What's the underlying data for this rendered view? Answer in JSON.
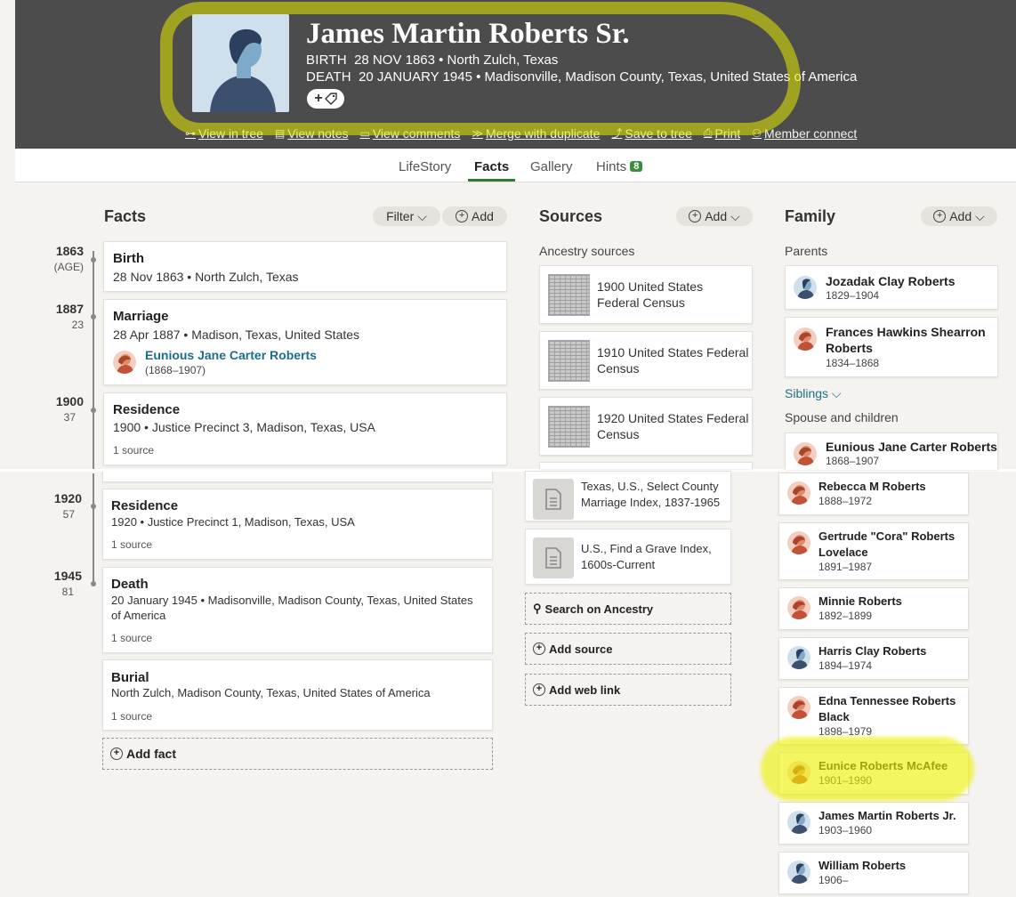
{
  "person": {
    "name": "James Martin Roberts Sr.",
    "birth_label": "BIRTH",
    "birth_value": "28 NOV 1863 • North Zulch, Texas",
    "death_label": "DEATH",
    "death_value": "20 JANUARY 1945 • Madisonville, Madison County, Texas, United States of America",
    "tag_button": "+"
  },
  "actions": [
    {
      "icon": "tree-icon",
      "label": "View in tree"
    },
    {
      "icon": "notes-icon",
      "label": "View notes"
    },
    {
      "icon": "comments-icon",
      "label": "View comments"
    },
    {
      "icon": "merge-icon",
      "label": "Merge with duplicate"
    },
    {
      "icon": "save-icon",
      "label": "Save to tree"
    },
    {
      "icon": "print-icon",
      "label": "Print"
    },
    {
      "icon": "member-icon",
      "label": "Member connect"
    }
  ],
  "tabs": [
    {
      "label": "LifeStory"
    },
    {
      "label": "Facts"
    },
    {
      "label": "Gallery"
    },
    {
      "label": "Hints",
      "badge": "8"
    }
  ],
  "facts": {
    "title": "Facts",
    "filter_label": "Filter",
    "add_label": "Add",
    "timeline": [
      {
        "year": "1863",
        "age": "(AGE)"
      },
      {
        "year": "1887",
        "age": "23"
      },
      {
        "year": "1900",
        "age": "37"
      },
      {
        "year": "1920",
        "age": "57"
      },
      {
        "year": "1945",
        "age": "81"
      }
    ],
    "items": [
      {
        "title": "Birth",
        "detail": "28 Nov 1863 • North Zulch, Texas"
      },
      {
        "title": "Marriage",
        "detail": "28 Apr 1887 • Madison, Texas, United States",
        "spouse": "Eunious Jane Carter Roberts",
        "spouse_dates": "(1868–1907)"
      },
      {
        "title": "Residence",
        "detail": "1900 • Justice Precinct 3, Madison, Texas, USA",
        "source": "1 source"
      },
      {
        "title": "Residence",
        "detail": "1920 • Justice Precinct 1, Madison, Texas, USA",
        "source": "1 source"
      },
      {
        "title": "Death",
        "detail": "20 January 1945 • Madisonville, Madison County, Texas, United States",
        "detail2": "of America",
        "source": "1 source"
      },
      {
        "title": "Burial",
        "detail": "North Zulch, Madison County, Texas, United States of America",
        "source": "1 source"
      }
    ],
    "add_fact": "Add fact"
  },
  "sources": {
    "title": "Sources",
    "add_label": "Add",
    "subtitle": "Ancestry sources",
    "items": [
      {
        "line1": "1900 United States",
        "line2": "Federal Census"
      },
      {
        "line1": "1910 United States Federal",
        "line2": "Census"
      },
      {
        "line1": "1920 United States Federal",
        "line2": "Census"
      },
      {
        "line1": "Texas, U.S., Select County",
        "line2": "Marriage Index, 1837-1965"
      },
      {
        "line1": "U.S., Find a Grave Index,",
        "line2": "1600s-Current"
      }
    ],
    "search": "Search on Ancestry",
    "add_source": "Add source",
    "add_web_link": "Add web link"
  },
  "family": {
    "title": "Family",
    "add_label": "Add",
    "parents_label": "Parents",
    "parents": [
      {
        "name": "Jozadak Clay Roberts",
        "dates": "1829–1904",
        "gender": "male"
      },
      {
        "name": "Frances Hawkins Shearron",
        "name2": "Roberts",
        "dates": "1834–1868",
        "gender": "female"
      }
    ],
    "siblings_label": "Siblings",
    "spouse_label": "Spouse and children",
    "spouse": {
      "name": "Eunious Jane Carter Roberts",
      "dates": "1868–1907",
      "gender": "female"
    },
    "children": [
      {
        "name": "Rebecca M Roberts",
        "dates": "1888–1972",
        "gender": "female"
      },
      {
        "name": "Gertrude \"Cora\" Roberts",
        "name2": "Lovelace",
        "dates": "1891–1987",
        "gender": "female"
      },
      {
        "name": "Minnie Roberts",
        "dates": "1892–1899",
        "gender": "female"
      },
      {
        "name": "Harris Clay Roberts",
        "dates": "1894–1974",
        "gender": "male"
      },
      {
        "name": "Edna Tennessee Roberts",
        "name2": "Black",
        "dates": "1898–1979",
        "gender": "female"
      },
      {
        "name": "Eunice Roberts McAfee",
        "dates": "1901–1990",
        "gender": "female"
      },
      {
        "name": "James Martin Roberts Jr.",
        "dates": "1903–1960",
        "gender": "male"
      },
      {
        "name": "William Roberts",
        "dates": "1906–",
        "gender": "male"
      }
    ]
  },
  "colors": {
    "header": "#4c4c4c",
    "link": "#1d6e8a",
    "accent_green": "#2e7d32",
    "highlight": "#eef000"
  }
}
